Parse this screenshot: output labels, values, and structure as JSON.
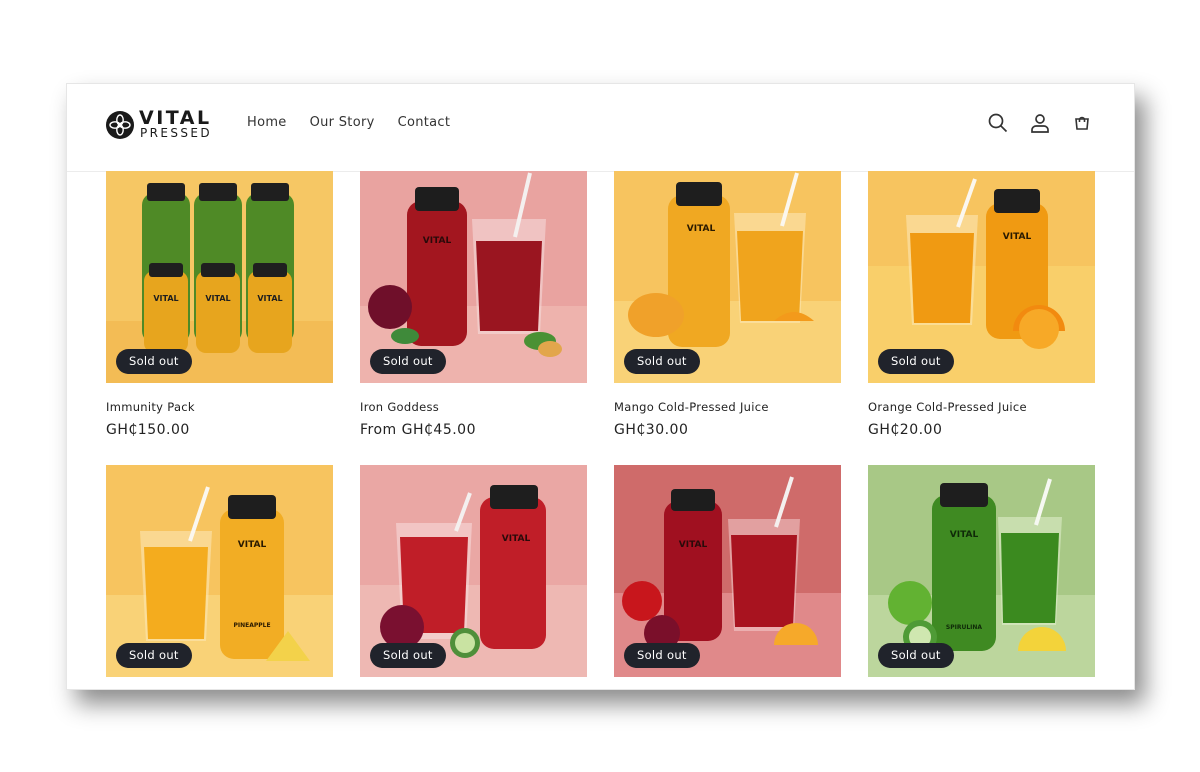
{
  "brand": {
    "name_top": "VITAL",
    "name_bottom": "PRESSED"
  },
  "nav": [
    {
      "label": "Home"
    },
    {
      "label": "Our Story"
    },
    {
      "label": "Contact"
    }
  ],
  "header_icons": [
    "search-icon",
    "account-icon",
    "cart-icon"
  ],
  "colors": {
    "badge_bg": "#20232b",
    "amber": "#f4c35a",
    "pink": "#e9a0a0",
    "rose": "#cf6a6a",
    "green": "#a9c987"
  },
  "products": [
    {
      "name": "Immunity Pack",
      "price": "GH₵150.00",
      "badge": "Sold out",
      "bottle_label": "VITAL"
    },
    {
      "name": "Iron Goddess",
      "price": "From GH₵45.00",
      "badge": "Sold out",
      "bottle_label": "VITAL"
    },
    {
      "name": "Mango Cold-Pressed Juice",
      "price": "GH₵30.00",
      "badge": "Sold out",
      "bottle_label": "VITAL"
    },
    {
      "name": "Orange Cold-Pressed Juice",
      "price": "GH₵20.00",
      "badge": "Sold out",
      "bottle_label": "VITAL"
    },
    {
      "name": "",
      "price": "",
      "badge": "Sold out",
      "bottle_label": "VITAL",
      "bottle_sublabel": "PINEAPPLE"
    },
    {
      "name": "",
      "price": "",
      "badge": "Sold out",
      "bottle_label": "VITAL"
    },
    {
      "name": "",
      "price": "",
      "badge": "Sold out",
      "bottle_label": "VITAL"
    },
    {
      "name": "",
      "price": "",
      "badge": "Sold out",
      "bottle_label": "VITAL",
      "bottle_sublabel": "SPIRULINA"
    }
  ]
}
